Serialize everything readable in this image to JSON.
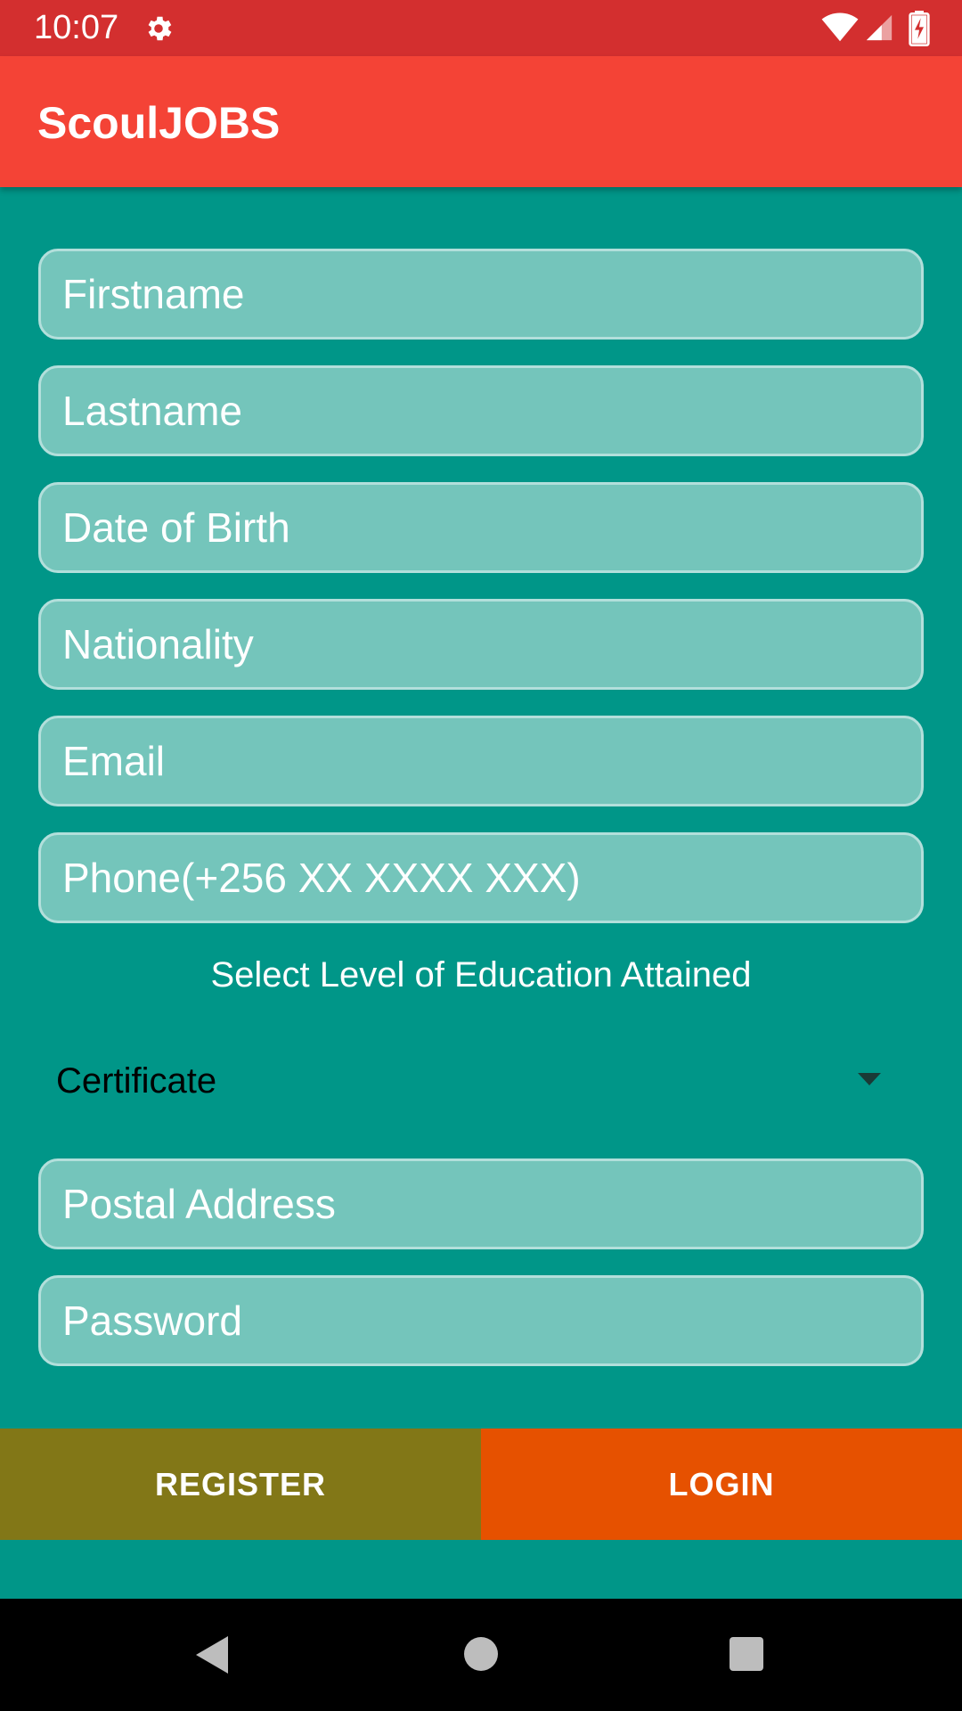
{
  "status_bar": {
    "time": "10:07",
    "icons": [
      "settings-gear-icon",
      "wifi-icon",
      "cell-signal-icon",
      "battery-charging-icon"
    ]
  },
  "app_bar": {
    "title": "ScoulJOBS",
    "color": "#f44336"
  },
  "form": {
    "firstname_placeholder": "Firstname",
    "lastname_placeholder": "Lastname",
    "dob_placeholder": "Date of Birth",
    "nationality_placeholder": "Nationality",
    "email_placeholder": "Email",
    "phone_placeholder": "Phone(+256 XX XXXX XXX)",
    "education_label": "Select Level of Education Attained",
    "education_selected": "Certificate",
    "postal_placeholder": "Postal Address",
    "password_placeholder": "Password"
  },
  "buttons": {
    "register_label": "REGISTER",
    "login_label": "LOGIN",
    "register_color": "#827717",
    "login_color": "#e65100"
  },
  "colors": {
    "background": "#009688",
    "field_fill": "#74c5bb",
    "status_bar": "#d32f2f"
  },
  "nav_bar": {
    "icons": [
      "back-icon",
      "home-icon",
      "recents-icon"
    ]
  }
}
